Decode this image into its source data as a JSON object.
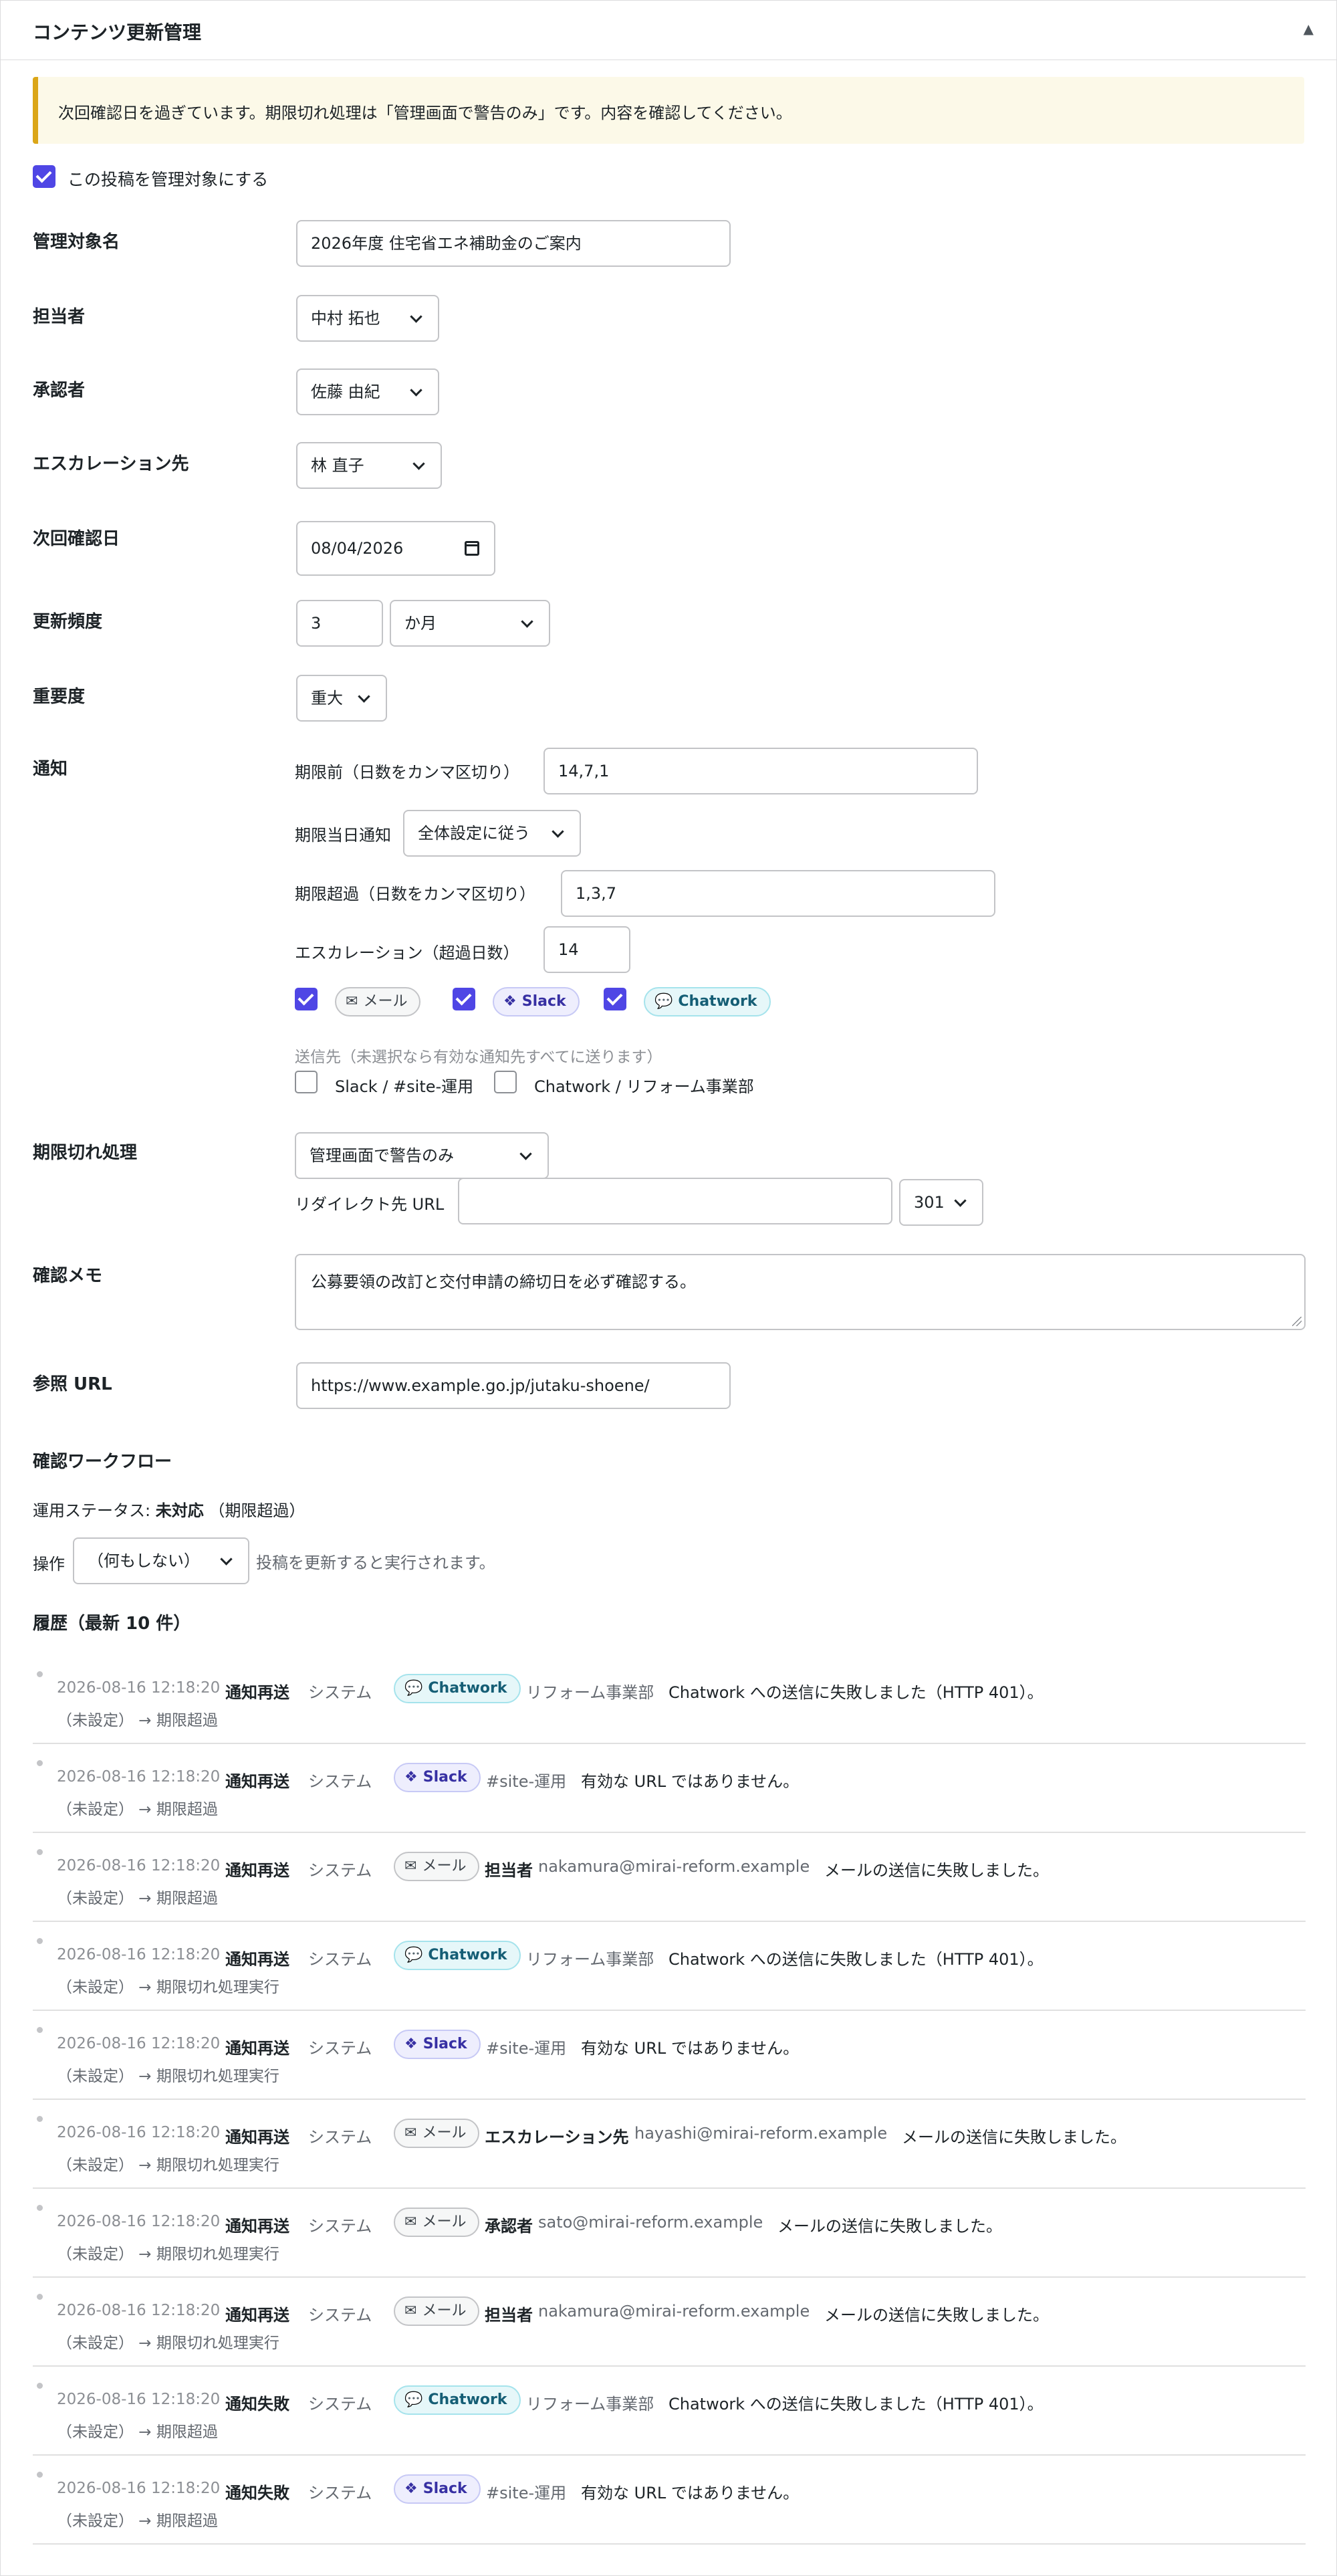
{
  "header": {
    "title": "コンテンツ更新管理",
    "toggle": "▲"
  },
  "notice": "次回確認日を過ぎています。期限切れ処理は「管理画面で警告のみ」です。内容を確認してください。",
  "manage_checkbox": {
    "label": "この投稿を管理対象にする",
    "checked": true
  },
  "fields": {
    "target_name": {
      "label": "管理対象名",
      "value": "2026年度 住宅省エネ補助金のご案内"
    },
    "owner": {
      "label": "担当者",
      "value": "中村 拓也"
    },
    "approver": {
      "label": "承認者",
      "value": "佐藤 由紀"
    },
    "escalation": {
      "label": "エスカレーション先",
      "value": "林 直子"
    },
    "next_check": {
      "label": "次回確認日",
      "value": "08/04/2026"
    },
    "frequency": {
      "label": "更新頻度",
      "number": "3",
      "unit": "か月"
    },
    "importance": {
      "label": "重要度",
      "value": "重大"
    }
  },
  "notify": {
    "label": "通知",
    "before_label": "期限前（日数をカンマ区切り）",
    "before_value": "14,7,1",
    "sameday_label": "期限当日通知",
    "sameday_value": "全体設定に従う",
    "after_label": "期限超過（日数をカンマ区切り）",
    "after_value": "1,3,7",
    "escalation_label": "エスカレーション（超過日数）",
    "escalation_value": "14",
    "channels": [
      {
        "name": "メール",
        "icon": "✉"
      },
      {
        "name": "Slack",
        "icon": "❖"
      },
      {
        "name": "Chatwork",
        "icon": "💬"
      }
    ],
    "dest_hint": "送信先（未選択なら有効な通知先すべてに送ります）",
    "destinations": [
      "Slack / #site-運用",
      "Chatwork / リフォーム事業部"
    ]
  },
  "expiry": {
    "label": "期限切れ処理",
    "value": "管理画面で警告のみ",
    "redirect_label": "リダイレクト先 URL",
    "redirect_value": "",
    "code": "301"
  },
  "memo": {
    "label": "確認メモ",
    "value": "公募要領の改訂と交付申請の締切日を必ず確認する。"
  },
  "ref_url": {
    "label": "参照 URL",
    "value": "https://www.example.go.jp/jutaku-shoene/"
  },
  "workflow": {
    "title": "確認ワークフロー",
    "status_prefix": "運用ステータス:",
    "status_value": "未対応",
    "status_suffix": "（期限超過）",
    "op_label": "操作",
    "op_value": "（何もしない）",
    "op_hint": "投稿を更新すると実行されます。"
  },
  "history": {
    "title": "履歴（最新 10 件）",
    "rows": [
      {
        "ts": "2026-08-16 12:18:20",
        "event": "通知再送",
        "actor": "システム",
        "channel": "Chatwork",
        "role": "",
        "dest": "リフォーム事業部",
        "msg": "Chatwork への送信に失敗しました（HTTP 401）。",
        "transition": "（未設定） → 期限超過"
      },
      {
        "ts": "2026-08-16 12:18:20",
        "event": "通知再送",
        "actor": "システム",
        "channel": "Slack",
        "role": "",
        "dest": "#site-運用",
        "msg": "有効な URL ではありません。",
        "transition": "（未設定） → 期限超過"
      },
      {
        "ts": "2026-08-16 12:18:20",
        "event": "通知再送",
        "actor": "システム",
        "channel": "メール",
        "role": "担当者",
        "dest": "nakamura@mirai-reform.example",
        "msg": "メールの送信に失敗しました。",
        "transition": "（未設定） → 期限超過"
      },
      {
        "ts": "2026-08-16 12:18:20",
        "event": "通知再送",
        "actor": "システム",
        "channel": "Chatwork",
        "role": "",
        "dest": "リフォーム事業部",
        "msg": "Chatwork への送信に失敗しました（HTTP 401）。",
        "transition": "（未設定） → 期限切れ処理実行"
      },
      {
        "ts": "2026-08-16 12:18:20",
        "event": "通知再送",
        "actor": "システム",
        "channel": "Slack",
        "role": "",
        "dest": "#site-運用",
        "msg": "有効な URL ではありません。",
        "transition": "（未設定） → 期限切れ処理実行"
      },
      {
        "ts": "2026-08-16 12:18:20",
        "event": "通知再送",
        "actor": "システム",
        "channel": "メール",
        "role": "エスカレーション先",
        "dest": "hayashi@mirai-reform.example",
        "msg": "メールの送信に失敗しました。",
        "transition": "（未設定） → 期限切れ処理実行"
      },
      {
        "ts": "2026-08-16 12:18:20",
        "event": "通知再送",
        "actor": "システム",
        "channel": "メール",
        "role": "承認者",
        "dest": "sato@mirai-reform.example",
        "msg": "メールの送信に失敗しました。",
        "transition": "（未設定） → 期限切れ処理実行"
      },
      {
        "ts": "2026-08-16 12:18:20",
        "event": "通知再送",
        "actor": "システム",
        "channel": "メール",
        "role": "担当者",
        "dest": "nakamura@mirai-reform.example",
        "msg": "メールの送信に失敗しました。",
        "transition": "（未設定） → 期限切れ処理実行"
      },
      {
        "ts": "2026-08-16 12:18:20",
        "event": "通知失敗",
        "actor": "システム",
        "channel": "Chatwork",
        "role": "",
        "dest": "リフォーム事業部",
        "msg": "Chatwork への送信に失敗しました（HTTP 401）。",
        "transition": "（未設定） → 期限超過"
      },
      {
        "ts": "2026-08-16 12:18:20",
        "event": "通知失敗",
        "actor": "システム",
        "channel": "Slack",
        "role": "",
        "dest": "#site-運用",
        "msg": "有効な URL ではありません。",
        "transition": "（未設定） → 期限超過"
      }
    ]
  }
}
